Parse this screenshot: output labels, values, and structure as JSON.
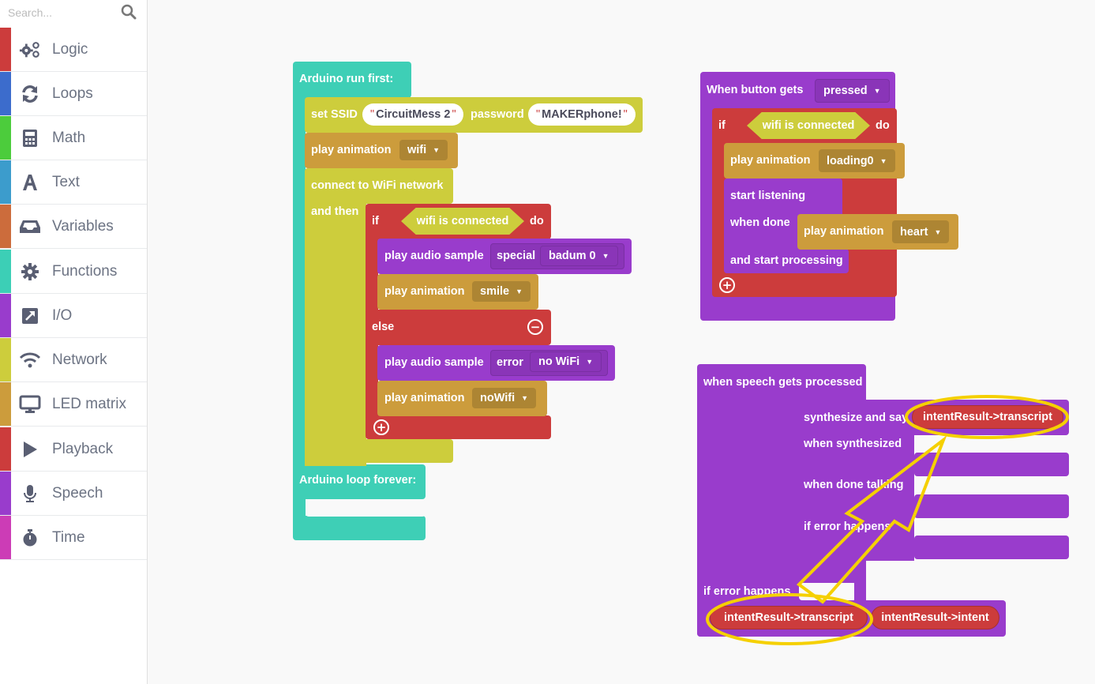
{
  "sidebar": {
    "search_placeholder": "Search...",
    "categories": [
      {
        "label": "Logic",
        "color": "#cc3c3c",
        "icon": "gears-icon"
      },
      {
        "label": "Loops",
        "color": "#3c6ccc",
        "icon": "refresh-icon"
      },
      {
        "label": "Math",
        "color": "#4ccc3c",
        "icon": "calculator-icon"
      },
      {
        "label": "Text",
        "color": "#3c9ccc",
        "icon": "text-a-icon"
      },
      {
        "label": "Variables",
        "color": "#cc6c3c",
        "icon": "inbox-icon"
      },
      {
        "label": "Functions",
        "color": "#3ccfb6",
        "icon": "gear-icon"
      },
      {
        "label": "I/O",
        "color": "#993ccc",
        "icon": "external-arrow-icon"
      },
      {
        "label": "Network",
        "color": "#cdcd3c",
        "icon": "wifi-icon"
      },
      {
        "label": "LED matrix",
        "color": "#cc9c3c",
        "icon": "monitor-icon"
      },
      {
        "label": "Playback",
        "color": "#cc3c3c",
        "icon": "play-icon"
      },
      {
        "label": "Speech",
        "color": "#993ccc",
        "icon": "microphone-icon"
      },
      {
        "label": "Time",
        "color": "#cc3cb6",
        "icon": "stopwatch-icon"
      }
    ]
  },
  "blocks": {
    "setup": {
      "run_first": "Arduino run first:",
      "loop_forever": "Arduino loop forever:",
      "set_ssid": "set SSID",
      "ssid_value": "CircuitMess 2",
      "password_label": "password",
      "password_value": "MAKERphone!",
      "play_animation": "play animation",
      "anim_wifi": "wifi",
      "connect_wifi": "connect to WiFi network",
      "and_then": "and then",
      "if": "if",
      "wifi_connected": "wifi is connected",
      "do": "do",
      "play_audio_sample": "play audio sample",
      "audio_cat_special": "special",
      "audio_badum": "badum 0",
      "anim_smile": "smile",
      "else": "else",
      "audio_cat_error": "error",
      "audio_nowifi": "no WiFi",
      "anim_nowifi": "noWifi"
    },
    "button": {
      "when_button": "When button  gets",
      "pressed": "pressed",
      "if": "if",
      "wifi_connected": "wifi is connected",
      "do": "do",
      "play_animation": "play animation",
      "anim_loading": "loading0",
      "start_listening": "start listening",
      "when_done": "when done",
      "anim_heart": "heart",
      "and_start_processing": "and start processing"
    },
    "speech": {
      "when_processed": "when speech gets processed",
      "synthesize_say": "synthesize and say",
      "transcript": "intentResult->transcript",
      "when_synthesized": "when synthesized",
      "when_done_talking": "when done talking",
      "if_error_inner": "if error happens",
      "if_error_outer": "if error happens",
      "var_transcript": "intentResult->transcript",
      "var_intent": "intentResult->intent"
    }
  },
  "annotation": {
    "color": "#f5d000"
  }
}
